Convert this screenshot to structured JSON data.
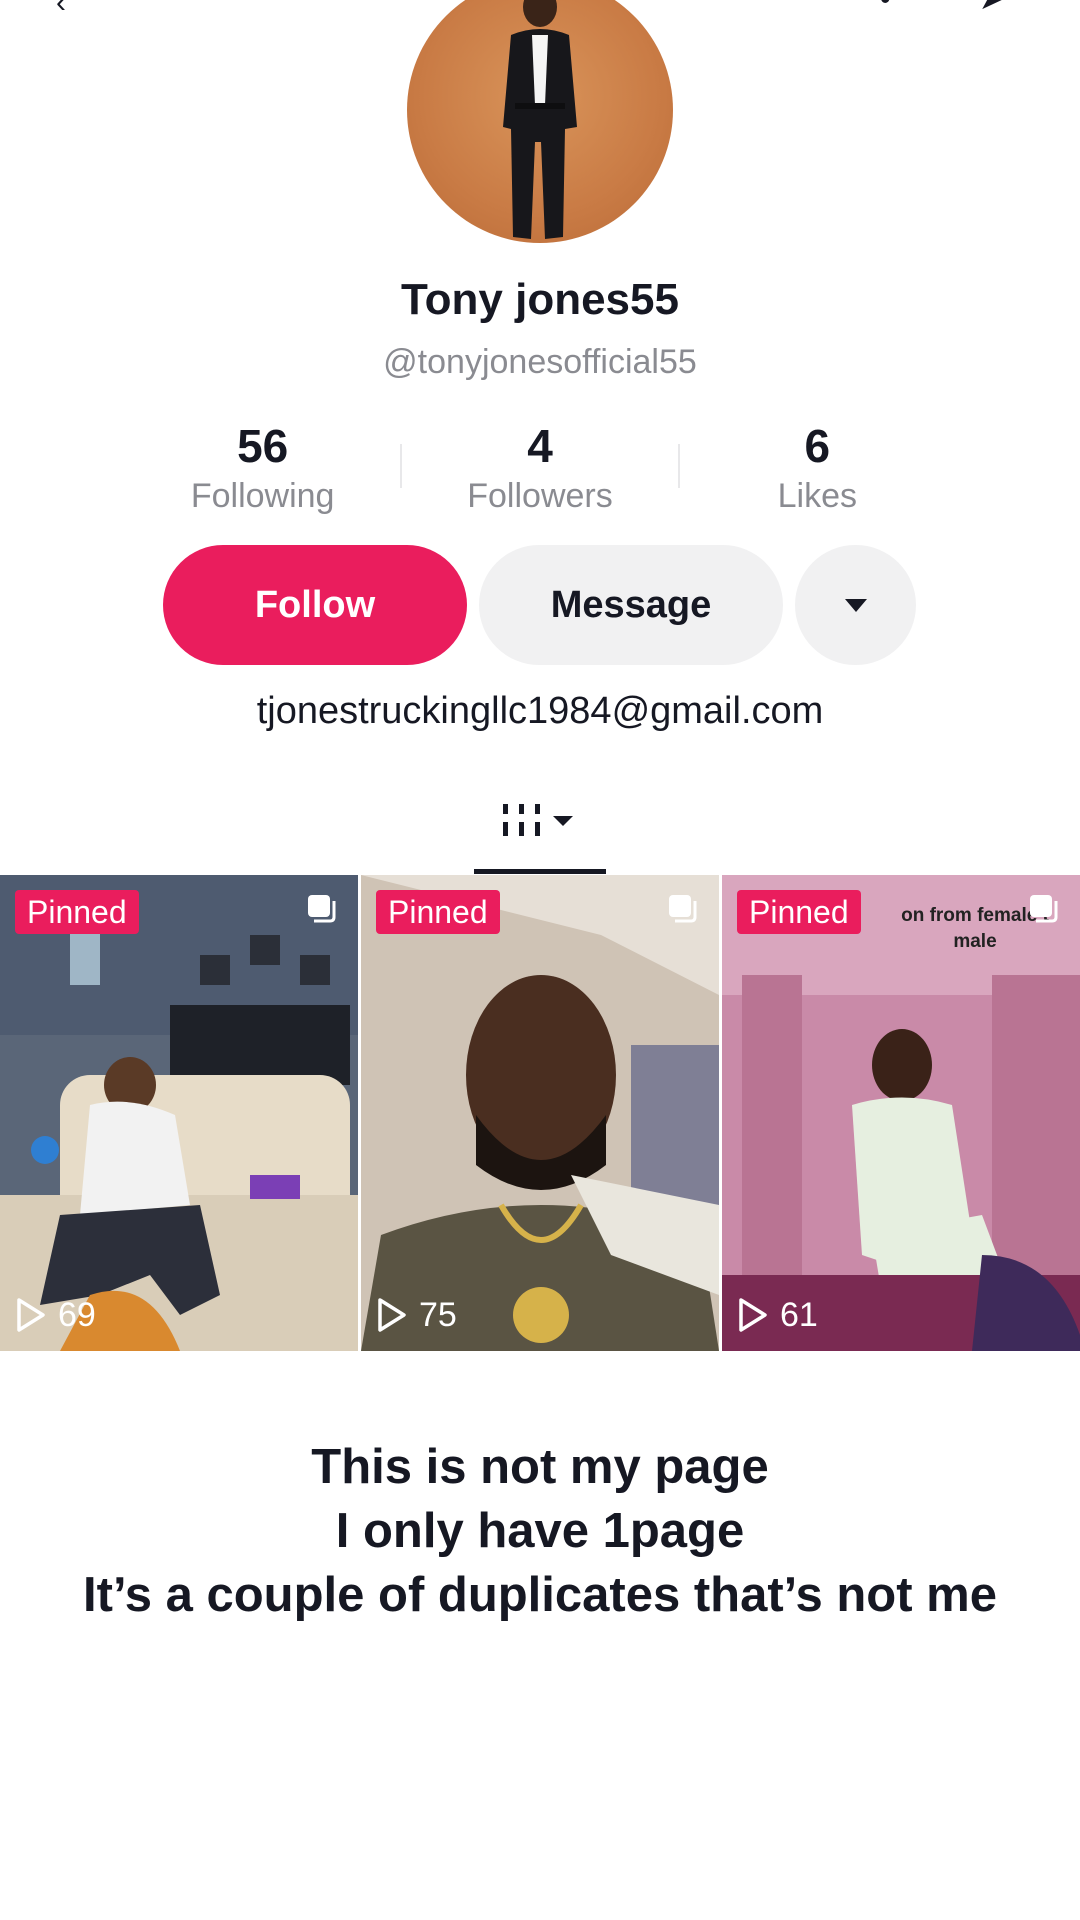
{
  "profile": {
    "display_name": "Tony jones55",
    "handle": "@tonyjonesofficial55",
    "bio": "tjonestruckingllc1984@gmail.com"
  },
  "stats": [
    {
      "value": "56",
      "label": "Following"
    },
    {
      "value": "4",
      "label": "Followers"
    },
    {
      "value": "6",
      "label": "Likes"
    }
  ],
  "actions": {
    "follow_label": "Follow",
    "message_label": "Message",
    "more_icon": "caret-down-icon"
  },
  "tabs": {
    "active_icon": "grid-filter-icon"
  },
  "videos": [
    {
      "badge": "Pinned",
      "plays": "69"
    },
    {
      "badge": "Pinned",
      "plays": "75"
    },
    {
      "badge": "Pinned",
      "plays": "61",
      "overlay_text": "on from female t\nmale"
    }
  ],
  "note_lines": [
    "This is not my page",
    "I only have 1page",
    "It’s a couple of duplicates that’s not me"
  ],
  "colors": {
    "accent": "#ea1d5d",
    "button_gray": "#f1f1f2",
    "muted_text": "#8a8b91"
  }
}
